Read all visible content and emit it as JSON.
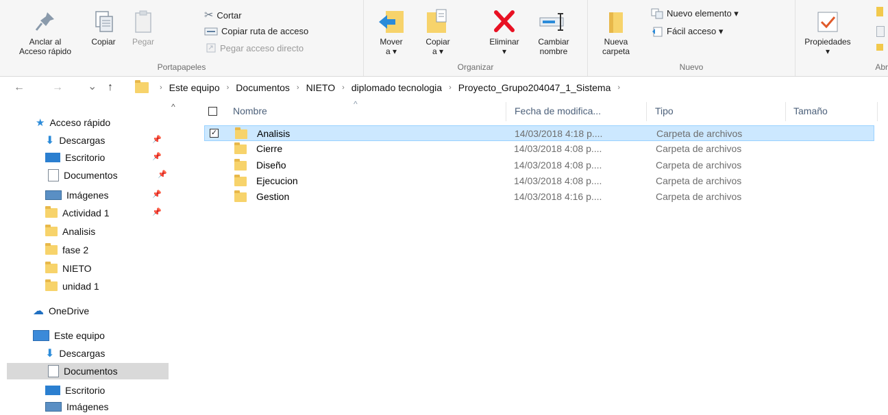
{
  "ribbon": {
    "portapapeles": {
      "label": "Portapapeles",
      "pin_label_1": "Anclar al",
      "pin_label_2": "Acceso rápido",
      "copy_label": "Copiar",
      "paste_label": "Pegar",
      "cut_label": "Cortar",
      "copy_path_label": "Copiar ruta de acceso",
      "paste_shortcut_label": "Pegar acceso directo"
    },
    "organizar": {
      "label": "Organizar",
      "move_label_1": "Mover",
      "move_label_2": "a ▾",
      "copyto_label_1": "Copiar",
      "copyto_label_2": "a ▾",
      "delete_label_1": "Eliminar",
      "delete_label_2": "▾",
      "rename_label_1": "Cambiar",
      "rename_label_2": "nombre"
    },
    "nuevo": {
      "label": "Nuevo",
      "new_folder_label_1": "Nueva",
      "new_folder_label_2": "carpeta",
      "new_item_label": "Nuevo elemento ▾",
      "easy_access_label": "Fácil acceso ▾"
    },
    "abrir": {
      "label": "Abr",
      "properties_label": "Propiedades",
      "properties_arrow": "▾"
    }
  },
  "address": {
    "back": "←",
    "forward": "→",
    "recent": "⌄",
    "up": "↑",
    "crumbs": [
      "Este equipo",
      "Documentos",
      "NIETO",
      "diplomado tecnologia",
      "Proyecto_Grupo204047_1_Sistema"
    ],
    "separator": "›"
  },
  "navpane": {
    "scroll_up": "^",
    "quick_access": "Acceso rápido",
    "quick_items": [
      {
        "label": "Descargas",
        "pin": "📌"
      },
      {
        "label": "Escritorio",
        "pin": "📌"
      },
      {
        "label": "Documentos",
        "pin": "📌"
      },
      {
        "label": "Imágenes",
        "pin": "📌"
      },
      {
        "label": "Actividad 1",
        "pin": "📌"
      },
      {
        "label": "Analisis"
      },
      {
        "label": "fase 2"
      },
      {
        "label": "NIETO"
      },
      {
        "label": "unidad 1"
      }
    ],
    "onedrive": "OneDrive",
    "this_pc": "Este equipo",
    "pc_items": [
      "Descargas",
      "Documentos",
      "Escritorio",
      "Imágenes"
    ]
  },
  "filelist": {
    "columns": {
      "name": "Nombre",
      "date": "Fecha de modifica...",
      "type": "Tipo",
      "size": "Tamaño",
      "sort_arrow": "^"
    },
    "rows": [
      {
        "name": "Analisis",
        "date": "14/03/2018 4:18 p....",
        "type": "Carpeta de archivos",
        "checked": "✓"
      },
      {
        "name": "Cierre",
        "date": "14/03/2018 4:08 p....",
        "type": "Carpeta de archivos"
      },
      {
        "name": "Diseño",
        "date": "14/03/2018 4:08 p....",
        "type": "Carpeta de archivos"
      },
      {
        "name": "Ejecucion",
        "date": "14/03/2018 4:08 p....",
        "type": "Carpeta de archivos"
      },
      {
        "name": "Gestion",
        "date": "14/03/2018 4:16 p....",
        "type": "Carpeta de archivos"
      }
    ]
  },
  "colors": {
    "selection_bg": "#cce8ff",
    "selection_border": "#99d1ff",
    "delete_red": "#e81123",
    "header_text": "#4c607a",
    "folder_yellow": "#f7d36b"
  }
}
